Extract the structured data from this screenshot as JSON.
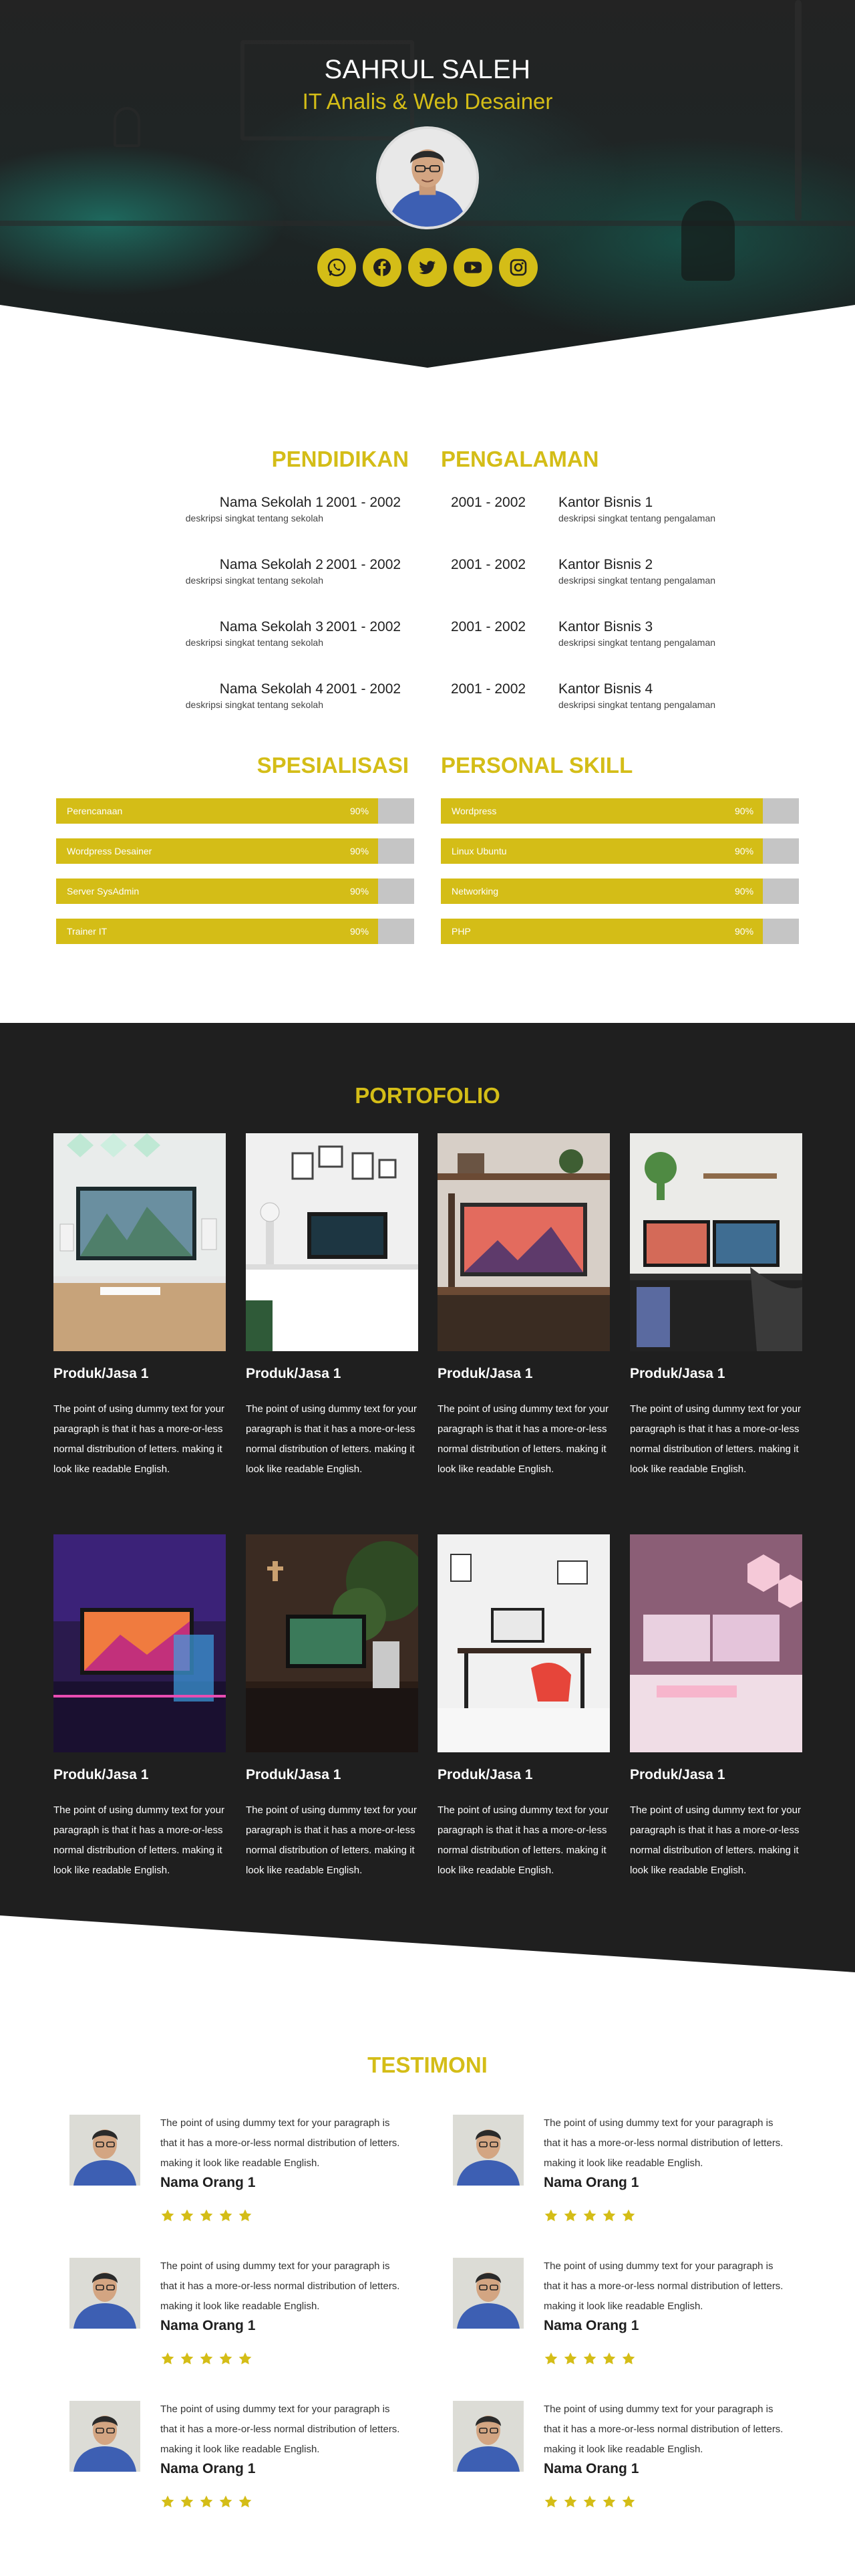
{
  "hero": {
    "name": "SAHRUL SALEH",
    "role": "IT Analis & Web Desainer",
    "socials": [
      "whatsapp-icon",
      "facebook-icon",
      "twitter-icon",
      "youtube-icon",
      "instagram-icon"
    ]
  },
  "education": {
    "title": "PENDIDIKAN",
    "items": [
      {
        "name": "Nama Sekolah 1",
        "year": "2001 - 2002",
        "desc": "deskripsi singkat tentang sekolah"
      },
      {
        "name": "Nama Sekolah 2",
        "year": "2001 - 2002",
        "desc": "deskripsi singkat tentang sekolah"
      },
      {
        "name": "Nama Sekolah 3",
        "year": "2001 - 2002",
        "desc": "deskripsi singkat tentang sekolah"
      },
      {
        "name": "Nama Sekolah 4",
        "year": "2001 - 2002",
        "desc": "deskripsi singkat tentang sekolah"
      }
    ]
  },
  "experience": {
    "title": "PENGALAMAN",
    "items": [
      {
        "name": "Kantor Bisnis 1",
        "year": "2001 - 2002",
        "desc": "deskripsi singkat tentang pengalaman"
      },
      {
        "name": "Kantor Bisnis 2",
        "year": "2001 - 2002",
        "desc": "deskripsi singkat tentang pengalaman"
      },
      {
        "name": "Kantor Bisnis 3",
        "year": "2001 - 2002",
        "desc": "deskripsi singkat tentang pengalaman"
      },
      {
        "name": "Kantor Bisnis 4",
        "year": "2001 - 2002",
        "desc": "deskripsi singkat tentang pengalaman"
      }
    ]
  },
  "specialization": {
    "title": "SPESIALISASI",
    "skills": [
      {
        "label": "Perencanaan",
        "pct_text": "90%",
        "value": 0.9
      },
      {
        "label": "Wordpress Desainer",
        "pct_text": "90%",
        "value": 0.9
      },
      {
        "label": "Server SysAdmin",
        "pct_text": "90%",
        "value": 0.9
      },
      {
        "label": "Trainer IT",
        "pct_text": "90%",
        "value": 0.9
      }
    ]
  },
  "personal_skill": {
    "title": "PERSONAL SKILL",
    "skills": [
      {
        "label": "Wordpress",
        "pct_text": "90%",
        "value": 0.9
      },
      {
        "label": "Linux Ubuntu",
        "pct_text": "90%",
        "value": 0.9
      },
      {
        "label": "Networking",
        "pct_text": "90%",
        "value": 0.9
      },
      {
        "label": "PHP",
        "pct_text": "90%",
        "value": 0.9
      }
    ]
  },
  "portfolio": {
    "title": "PORTOFOLIO",
    "items": [
      {
        "title": "Produk/Jasa 1",
        "text": "The point of using dummy text for your paragraph is that it has a more-or-less normal distribution of letters. making it look like readable English."
      },
      {
        "title": "Produk/Jasa 1",
        "text": "The point of using dummy text for your paragraph is that it has a more-or-less normal distribution of letters. making it look like readable English."
      },
      {
        "title": "Produk/Jasa 1",
        "text": "The point of using dummy text for your paragraph is that it has a more-or-less normal distribution of letters. making it look like readable English."
      },
      {
        "title": "Produk/Jasa 1",
        "text": "The point of using dummy text for your paragraph is that it has a more-or-less normal distribution of letters. making it look like readable English."
      },
      {
        "title": "Produk/Jasa 1",
        "text": "The point of using dummy text for your paragraph is that it has a more-or-less normal distribution of letters. making it look like readable English."
      },
      {
        "title": "Produk/Jasa 1",
        "text": "The point of using dummy text for your paragraph is that it has a more-or-less normal distribution of letters. making it look like readable English."
      },
      {
        "title": "Produk/Jasa 1",
        "text": "The point of using dummy text for your paragraph is that it has a more-or-less normal distribution of letters. making it look like readable English."
      },
      {
        "title": "Produk/Jasa 1",
        "text": "The point of using dummy text for your paragraph is that it has a more-or-less normal distribution of letters. making it look like readable English."
      }
    ]
  },
  "testimoni": {
    "title": "TESTIMONI",
    "items": [
      {
        "text": "The point of using dummy text for your paragraph is that it has a more-or-less normal distribution of letters. making it look like readable English.",
        "name": "Nama Orang 1",
        "stars": 5
      },
      {
        "text": "The point of using dummy text for your paragraph is that it has a more-or-less normal distribution of letters. making it look like readable English.",
        "name": "Nama Orang 1",
        "stars": 5
      },
      {
        "text": "The point of using dummy text for your paragraph is that it has a more-or-less normal distribution of letters. making it look like readable English.",
        "name": "Nama Orang 1",
        "stars": 5
      },
      {
        "text": "The point of using dummy text for your paragraph is that it has a more-or-less normal distribution of letters. making it look like readable English.",
        "name": "Nama Orang 1",
        "stars": 5
      },
      {
        "text": "The point of using dummy text for your paragraph is that it has a more-or-less normal distribution of letters. making it look like readable English.",
        "name": "Nama Orang 1",
        "stars": 5
      },
      {
        "text": "The point of using dummy text for your paragraph is that it has a more-or-less normal distribution of letters. making it look like readable English.",
        "name": "Nama Orang 1",
        "stars": 5
      }
    ]
  },
  "colors": {
    "accent": "#d4bd17",
    "dark": "#1f1f1f",
    "track": "#c5c5c5"
  }
}
